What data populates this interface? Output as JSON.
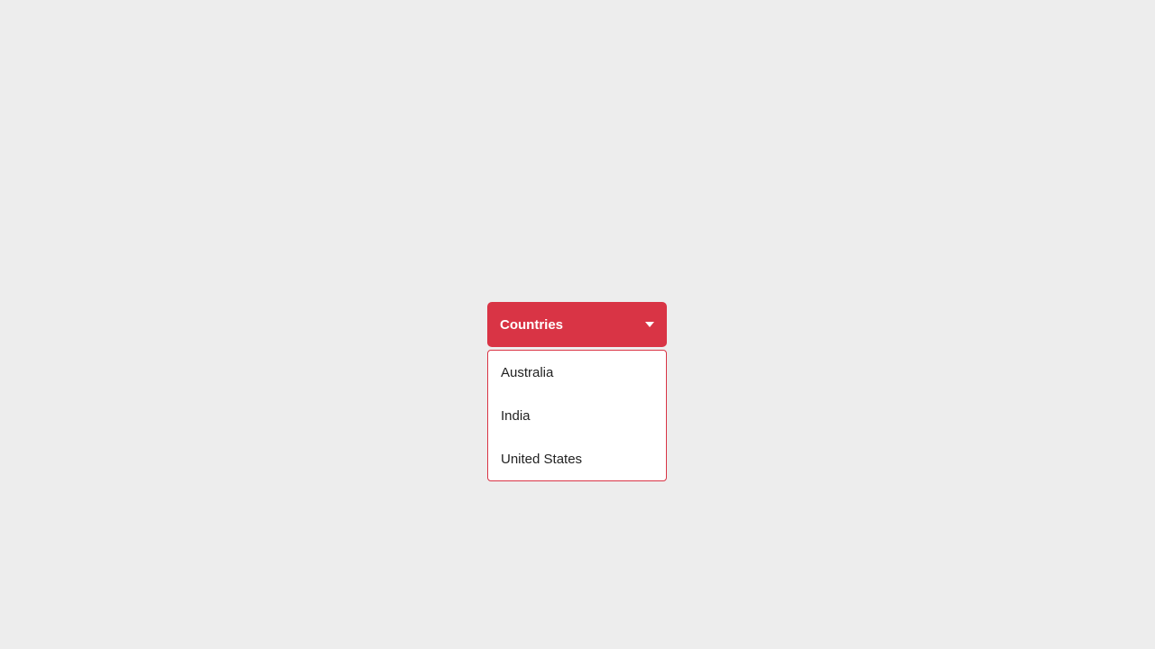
{
  "dropdown": {
    "label": "Countries",
    "items": [
      {
        "label": "Australia"
      },
      {
        "label": "India"
      },
      {
        "label": "United States"
      }
    ]
  },
  "colors": {
    "accent": "#d93445",
    "panel_bg": "#ffffff",
    "page_bg": "#ededed",
    "text": "#222222"
  }
}
